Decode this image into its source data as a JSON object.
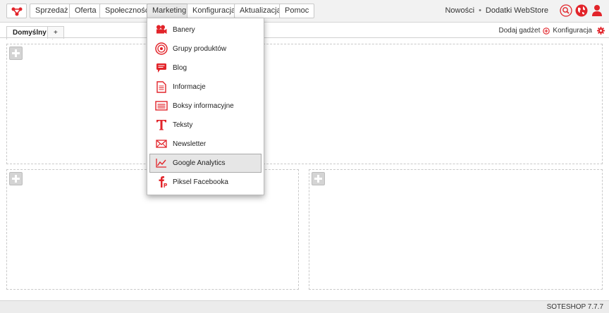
{
  "colors": {
    "brand": "#e2242a",
    "hover_bg": "#e6e6e6"
  },
  "nav": {
    "items": [
      {
        "label": "Sprzedaż"
      },
      {
        "label": "Oferta"
      },
      {
        "label": "Społeczność"
      },
      {
        "label": "Marketing"
      },
      {
        "label": "Konfiguracja"
      },
      {
        "label": "Aktualizacja"
      },
      {
        "label": "Pomoc"
      }
    ],
    "active": "Marketing"
  },
  "header_right": {
    "news": "Nowości",
    "separator": "•",
    "addons": "Dodatki WebStore",
    "icons": [
      "search-icon",
      "globe-icon",
      "user-icon"
    ]
  },
  "tabs": {
    "items": [
      {
        "label": "Domyślny"
      },
      {
        "label": "+"
      }
    ],
    "actions": {
      "add_gadget": "Dodaj gadżet",
      "config": "Konfiguracja"
    }
  },
  "marketing_menu": {
    "items": [
      {
        "label": "Banery",
        "icon": "film-camera-icon"
      },
      {
        "label": "Grupy produktów",
        "icon": "target-icon"
      },
      {
        "label": "Blog",
        "icon": "chat-bubble-icon"
      },
      {
        "label": "Informacje",
        "icon": "document-icon"
      },
      {
        "label": "Boksy informacyjne",
        "icon": "box-list-icon"
      },
      {
        "label": "Teksty",
        "icon": "text-t-icon"
      },
      {
        "label": "Newsletter",
        "icon": "envelope-icon"
      },
      {
        "label": "Google Analytics",
        "icon": "line-chart-icon"
      },
      {
        "label": "Piksel Facebooka",
        "icon": "facebook-pixel-icon"
      }
    ],
    "hovered": "Google Analytics"
  },
  "footer": {
    "version": "SOTESHOP 7.7.7"
  }
}
